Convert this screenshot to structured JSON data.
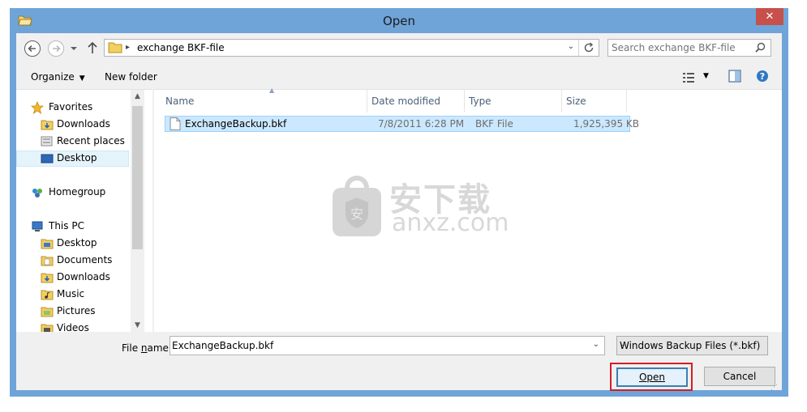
{
  "window": {
    "title": "Open",
    "close_glyph": "✕",
    "icon": "folder-open-icon"
  },
  "address_bar": {
    "path": "exchange BKF-file",
    "separator": "▸",
    "dropdown_glyph": "⌄",
    "refresh_icon": "refresh-icon"
  },
  "search": {
    "placeholder": "Search exchange BKF-file"
  },
  "toolbar": {
    "organize_label": "Organize",
    "organize_caret": "▼",
    "new_folder_label": "New folder",
    "view_caret": "▼"
  },
  "nav_pane": {
    "favorites": "Favorites",
    "downloads": "Downloads",
    "recent_places": "Recent places",
    "desktop": "Desktop",
    "homegroup": "Homegroup",
    "this_pc": "This PC",
    "pc_desktop": "Desktop",
    "documents": "Documents",
    "pc_downloads": "Downloads",
    "music": "Music",
    "pictures": "Pictures",
    "videos": "Videos",
    "scroll_up": "▲",
    "scroll_down": "▼"
  },
  "file_list": {
    "columns": {
      "name": "Name",
      "date_modified": "Date modified",
      "type": "Type",
      "size": "Size"
    },
    "sort_glyph": "▲",
    "rows": [
      {
        "name": "ExchangeBackup.bkf",
        "date_modified": "7/8/2011 6:28 PM",
        "type": "BKF File",
        "size": "1,925,395 KB"
      }
    ]
  },
  "watermark": {
    "text": "安下载",
    "sub": "anxz.com",
    "badge": "安"
  },
  "bottom": {
    "file_name_label_pre": "File ",
    "file_name_label_accel": "n",
    "file_name_label_post": "ame:",
    "file_name_value": "ExchangeBackup.bkf",
    "file_name_dropdown": "⌄",
    "file_type_value": "Windows Backup Files (*.bkf)",
    "file_type_dropdown": "⌄",
    "open_label": "Open",
    "cancel_label": "Cancel",
    "grip": "⋰"
  }
}
